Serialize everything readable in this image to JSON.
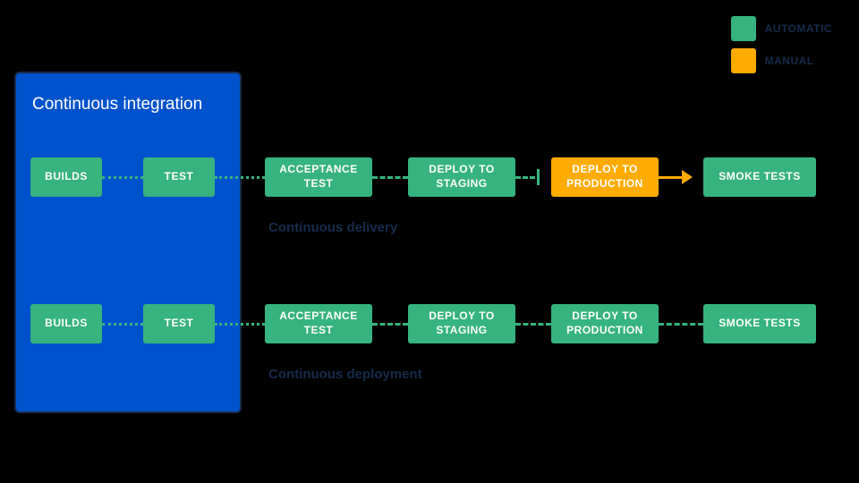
{
  "colors": {
    "automatic": "#36b37e",
    "manual": "#ffab00",
    "panel": "#0052cc",
    "caption": "#172b4d"
  },
  "legend": {
    "automatic": "AUTOMATIC",
    "manual": "MANUAL"
  },
  "ci_panel_title": "Continuous integration",
  "row1": {
    "builds": "BUILDS",
    "test": "TEST",
    "acceptance": "ACCEPTANCE TEST",
    "staging": "DEPLOY TO STAGING",
    "production": "DEPLOY TO PRODUCTION",
    "smoke": "SMOKE TESTS",
    "caption": "Continuous delivery"
  },
  "row2": {
    "builds": "BUILDS",
    "test": "TEST",
    "acceptance": "ACCEPTANCE TEST",
    "staging": "DEPLOY TO STAGING",
    "production": "DEPLOY TO PRODUCTION",
    "smoke": "SMOKE TESTS",
    "caption": "Continuous deployment"
  }
}
